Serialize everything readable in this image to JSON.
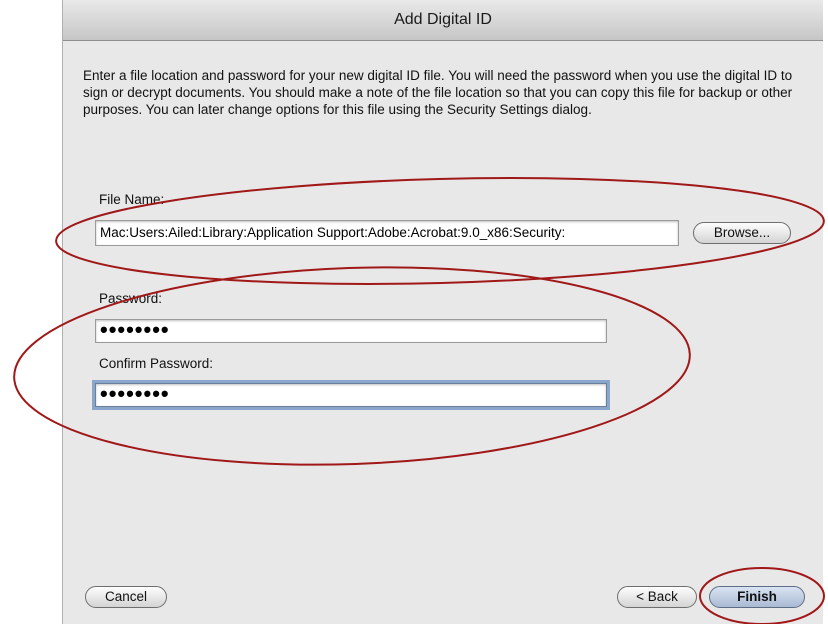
{
  "window": {
    "title": "Add Digital ID"
  },
  "description": "Enter a file location and password for your new digital ID file. You will need the password when you use the digital ID to sign or decrypt documents. You should make a note of the file location so that you can copy this file for backup or other purposes. You can later change options for this file using the Security Settings dialog.",
  "file": {
    "label": "File Name:",
    "value": "Mac:Users:Ailed:Library:Application Support:Adobe:Acrobat:9.0_x86:Security:",
    "browse_label": "Browse..."
  },
  "password": {
    "label": "Password:",
    "value": "••••••••"
  },
  "confirm": {
    "label": "Confirm Password:",
    "value": "••••••••"
  },
  "buttons": {
    "cancel": "Cancel",
    "back": "< Back",
    "finish": "Finish"
  },
  "annotation_color": "#a01818"
}
